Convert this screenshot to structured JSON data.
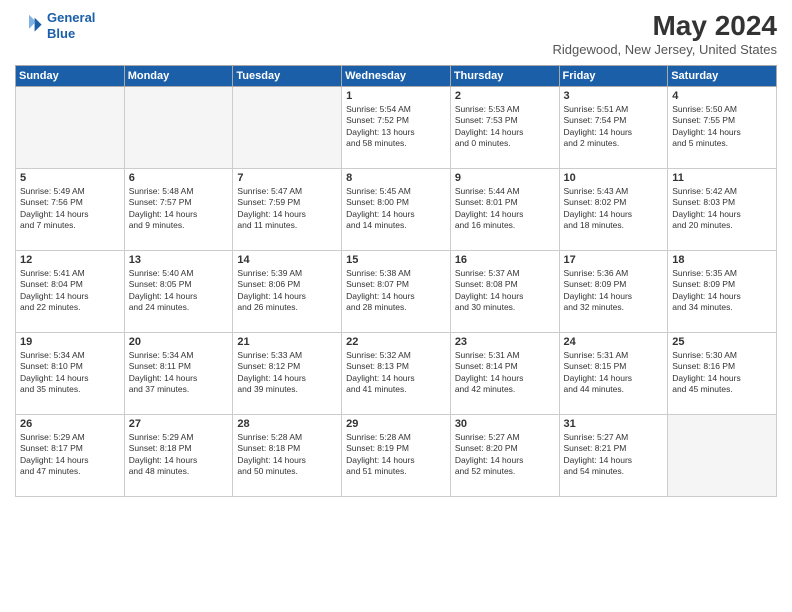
{
  "header": {
    "logo_line1": "General",
    "logo_line2": "Blue",
    "month_title": "May 2024",
    "location": "Ridgewood, New Jersey, United States"
  },
  "weekdays": [
    "Sunday",
    "Monday",
    "Tuesday",
    "Wednesday",
    "Thursday",
    "Friday",
    "Saturday"
  ],
  "weeks": [
    [
      {
        "day": "",
        "content": ""
      },
      {
        "day": "",
        "content": ""
      },
      {
        "day": "",
        "content": ""
      },
      {
        "day": "1",
        "content": "Sunrise: 5:54 AM\nSunset: 7:52 PM\nDaylight: 13 hours\nand 58 minutes."
      },
      {
        "day": "2",
        "content": "Sunrise: 5:53 AM\nSunset: 7:53 PM\nDaylight: 14 hours\nand 0 minutes."
      },
      {
        "day": "3",
        "content": "Sunrise: 5:51 AM\nSunset: 7:54 PM\nDaylight: 14 hours\nand 2 minutes."
      },
      {
        "day": "4",
        "content": "Sunrise: 5:50 AM\nSunset: 7:55 PM\nDaylight: 14 hours\nand 5 minutes."
      }
    ],
    [
      {
        "day": "5",
        "content": "Sunrise: 5:49 AM\nSunset: 7:56 PM\nDaylight: 14 hours\nand 7 minutes."
      },
      {
        "day": "6",
        "content": "Sunrise: 5:48 AM\nSunset: 7:57 PM\nDaylight: 14 hours\nand 9 minutes."
      },
      {
        "day": "7",
        "content": "Sunrise: 5:47 AM\nSunset: 7:59 PM\nDaylight: 14 hours\nand 11 minutes."
      },
      {
        "day": "8",
        "content": "Sunrise: 5:45 AM\nSunset: 8:00 PM\nDaylight: 14 hours\nand 14 minutes."
      },
      {
        "day": "9",
        "content": "Sunrise: 5:44 AM\nSunset: 8:01 PM\nDaylight: 14 hours\nand 16 minutes."
      },
      {
        "day": "10",
        "content": "Sunrise: 5:43 AM\nSunset: 8:02 PM\nDaylight: 14 hours\nand 18 minutes."
      },
      {
        "day": "11",
        "content": "Sunrise: 5:42 AM\nSunset: 8:03 PM\nDaylight: 14 hours\nand 20 minutes."
      }
    ],
    [
      {
        "day": "12",
        "content": "Sunrise: 5:41 AM\nSunset: 8:04 PM\nDaylight: 14 hours\nand 22 minutes."
      },
      {
        "day": "13",
        "content": "Sunrise: 5:40 AM\nSunset: 8:05 PM\nDaylight: 14 hours\nand 24 minutes."
      },
      {
        "day": "14",
        "content": "Sunrise: 5:39 AM\nSunset: 8:06 PM\nDaylight: 14 hours\nand 26 minutes."
      },
      {
        "day": "15",
        "content": "Sunrise: 5:38 AM\nSunset: 8:07 PM\nDaylight: 14 hours\nand 28 minutes."
      },
      {
        "day": "16",
        "content": "Sunrise: 5:37 AM\nSunset: 8:08 PM\nDaylight: 14 hours\nand 30 minutes."
      },
      {
        "day": "17",
        "content": "Sunrise: 5:36 AM\nSunset: 8:09 PM\nDaylight: 14 hours\nand 32 minutes."
      },
      {
        "day": "18",
        "content": "Sunrise: 5:35 AM\nSunset: 8:09 PM\nDaylight: 14 hours\nand 34 minutes."
      }
    ],
    [
      {
        "day": "19",
        "content": "Sunrise: 5:34 AM\nSunset: 8:10 PM\nDaylight: 14 hours\nand 35 minutes."
      },
      {
        "day": "20",
        "content": "Sunrise: 5:34 AM\nSunset: 8:11 PM\nDaylight: 14 hours\nand 37 minutes."
      },
      {
        "day": "21",
        "content": "Sunrise: 5:33 AM\nSunset: 8:12 PM\nDaylight: 14 hours\nand 39 minutes."
      },
      {
        "day": "22",
        "content": "Sunrise: 5:32 AM\nSunset: 8:13 PM\nDaylight: 14 hours\nand 41 minutes."
      },
      {
        "day": "23",
        "content": "Sunrise: 5:31 AM\nSunset: 8:14 PM\nDaylight: 14 hours\nand 42 minutes."
      },
      {
        "day": "24",
        "content": "Sunrise: 5:31 AM\nSunset: 8:15 PM\nDaylight: 14 hours\nand 44 minutes."
      },
      {
        "day": "25",
        "content": "Sunrise: 5:30 AM\nSunset: 8:16 PM\nDaylight: 14 hours\nand 45 minutes."
      }
    ],
    [
      {
        "day": "26",
        "content": "Sunrise: 5:29 AM\nSunset: 8:17 PM\nDaylight: 14 hours\nand 47 minutes."
      },
      {
        "day": "27",
        "content": "Sunrise: 5:29 AM\nSunset: 8:18 PM\nDaylight: 14 hours\nand 48 minutes."
      },
      {
        "day": "28",
        "content": "Sunrise: 5:28 AM\nSunset: 8:18 PM\nDaylight: 14 hours\nand 50 minutes."
      },
      {
        "day": "29",
        "content": "Sunrise: 5:28 AM\nSunset: 8:19 PM\nDaylight: 14 hours\nand 51 minutes."
      },
      {
        "day": "30",
        "content": "Sunrise: 5:27 AM\nSunset: 8:20 PM\nDaylight: 14 hours\nand 52 minutes."
      },
      {
        "day": "31",
        "content": "Sunrise: 5:27 AM\nSunset: 8:21 PM\nDaylight: 14 hours\nand 54 minutes."
      },
      {
        "day": "",
        "content": ""
      }
    ]
  ]
}
